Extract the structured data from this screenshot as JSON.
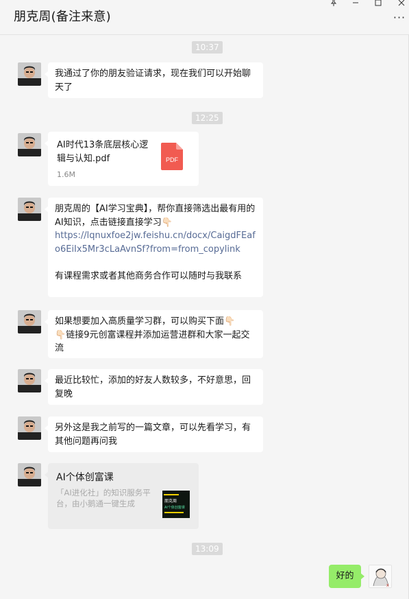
{
  "window": {
    "title": "朋克周(备注来意)",
    "more_label": "···",
    "controls": {
      "pin": "pin-icon",
      "minimize": "minimize-icon",
      "maximize": "maximize-icon",
      "close": "close-icon"
    }
  },
  "timestamps": {
    "t1": "10:37",
    "t2": "12:25",
    "t3": "13:09"
  },
  "messages": {
    "m1": "我通过了你的朋友验证请求，现在我们可以开始聊天了",
    "file": {
      "name": "AI时代13条底层核心逻辑与认知.pdf",
      "size": "1.6M",
      "icon_text": "PDF"
    },
    "m3": {
      "text_before": "朋克周的【AI学习宝典】，帮你直接筛选出最有用的AI知识，点击链接直接学习",
      "emoji": "👇🏻",
      "link": "https://lqnuxfoe2jw.feishu.cn/docx/CaigdFEafo6EiIx5Mr3cLaAvnSf?from=from_copylink",
      "text_after": "有课程需求或者其他商务合作可以随时与我联系"
    },
    "m4": {
      "text_a": "如果想要加入高质量学习群，可以购买下面",
      "emoji1": "👇🏻",
      "emoji2": "👇🏻",
      "text_b": "链接9元创富课程并添加运营进群和大家一起交流"
    },
    "m5": "最近比较忙，添加的好友人数较多，不好意思，回复晚",
    "m6": "另外这是我之前写的一篇文章，可以先看学习，有其他问题再问我",
    "card": {
      "title": "AI个体创富课",
      "desc": "「AI进化社」的知识服务平台，由小鹅通一键生成",
      "thumb_line1": "朋克周",
      "thumb_line2": "AI个体创富课"
    },
    "mine": "好的"
  },
  "colors": {
    "my_bubble": "#95ec69",
    "link": "#576b95",
    "pdf": "#f15b51"
  }
}
